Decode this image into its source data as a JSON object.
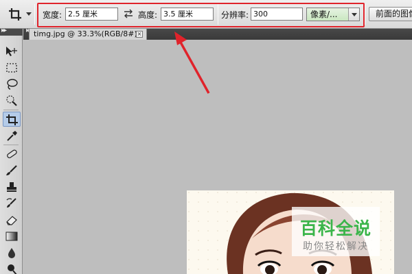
{
  "options_bar": {
    "tool_preset_icon": "crop-icon",
    "width_label": "宽度:",
    "width_value": "2.5 厘米",
    "swap_icon": "swap-arrows-icon",
    "height_label": "高度:",
    "height_value": "3.5 厘米",
    "resolution_label": "分辨率:",
    "resolution_value": "300",
    "resolution_unit": "像素/...",
    "front_image_button": "前面的图像"
  },
  "document_tab": {
    "title": "timg.jpg @ 33.3%(RGB/8#)",
    "close_label": "×"
  },
  "tools": [
    "move-tool-icon",
    "marquee-tool-icon",
    "lasso-tool-icon",
    "quick-selection-tool-icon",
    "crop-tool-icon",
    "eyedropper-tool-icon",
    "healing-brush-tool-icon",
    "brush-tool-icon",
    "clone-stamp-tool-icon",
    "history-brush-tool-icon",
    "eraser-tool-icon",
    "gradient-tool-icon",
    "blur-tool-icon",
    "dodge-tool-icon"
  ],
  "active_tool": "crop-tool-icon",
  "watermark": {
    "title": "百科全说",
    "subtitle": "助你轻松解决"
  },
  "colors": {
    "highlight": "#e0232b",
    "watermark_green": "#3bb54a",
    "canvas_bg": "#bebebe"
  }
}
